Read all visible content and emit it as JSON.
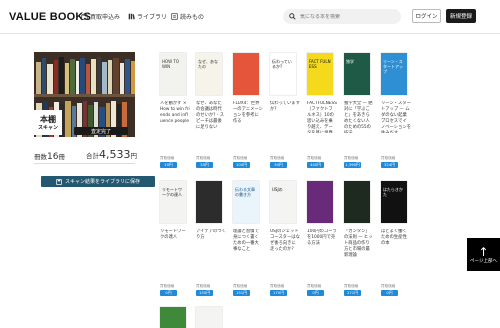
{
  "header": {
    "logo": "VALUE BOOKS",
    "nav": [
      {
        "label": "買取申込み",
        "icon": "box-icon"
      },
      {
        "label": "ライブラリ",
        "icon": "library-icon"
      },
      {
        "label": "読みもの",
        "icon": "reading-icon"
      }
    ],
    "search_placeholder": "気になる本を検索",
    "login_label": "ログイン",
    "register_label": "新規登録"
  },
  "shelf": {
    "tag_line1": "本棚",
    "tag_line2": "スキャン",
    "appraise_label": "査定完了",
    "count_prefix": "冊数",
    "count_value": "16",
    "count_unit": "冊",
    "total_prefix": "合計",
    "total_value": "4,533",
    "total_unit": "円",
    "save_label": "スキャン結果をライブラリに保存"
  },
  "books": [
    {
      "title": "人を動かす × How to win friends and influence people",
      "cover_text": "HOW TO WIN",
      "cover_color": "#f2f2ee",
      "text_color": "#333",
      "grade_label": "買取価格",
      "grade": "10円"
    },
    {
      "title": "なぜ、あなたの会議は時代のせいか? - スピーチは最後に足りない",
      "cover_text": "なぜ、あなたの",
      "cover_color": "#f6f3ea",
      "text_color": "#333",
      "grade_label": "買取価格",
      "grade": "30円"
    },
    {
      "title": "FLUX4：世界一のアニメーションを参考に作る",
      "cover_text": "",
      "cover_color": "#e4553c",
      "text_color": "#fff",
      "grade_label": "買取価格",
      "grade": "100円"
    },
    {
      "title": "伝わっていますか?",
      "cover_text": "伝わっているか?",
      "cover_color": "#ffffff",
      "text_color": "#111",
      "grade_label": "買取価格",
      "grade": "30円"
    },
    {
      "title": "FACTFULNESS（ファクトフルネス）10の思い込みを乗り越え、データを基に世界を正しく見る習慣",
      "cover_text": "FACT FULNESS",
      "cover_color": "#f4d91c",
      "text_color": "#111",
      "grade_label": "買取価格",
      "grade": "440円"
    },
    {
      "title": "独学大全 — 絶対に「学ぶこと」をあきらめたくない人のための55の技法",
      "cover_text": "独学",
      "cover_color": "#1e5a45",
      "text_color": "#fff",
      "grade_label": "買取価格",
      "grade": "1,390円"
    },
    {
      "title": "リーン・スタートアップ — ムダのない起業プロセスでイノベーションを生みだす",
      "cover_text": "リーン・スタートアップ",
      "cover_color": "#2f8fd4",
      "text_color": "#fff",
      "grade_label": "買取価格",
      "grade": "324円"
    },
    {
      "title": "リモートワークの達人",
      "cover_text": "リモートワークの達人",
      "cover_color": "#f3f3f1",
      "text_color": "#222",
      "grade_label": "買取価格",
      "grade": "0円"
    },
    {
      "title": "アイデアのつくり方",
      "cover_text": "",
      "cover_color": "#2c2c2c",
      "text_color": "#fff",
      "grade_label": "買取価格",
      "grade": "150円"
    },
    {
      "title": "理論と習慣で身につく書くための一番大事なこと",
      "cover_text": "伝わる文章の書き方",
      "cover_color": "#e9f4fb",
      "text_color": "#1b4f8a",
      "grade_label": "買取価格",
      "grade": "151円"
    },
    {
      "title": "USJのジェットコースターはなぜ後ろ向きに走ったのか?",
      "cover_text": "USJの",
      "cover_color": "#f4f4f2",
      "text_color": "#111",
      "grade_label": "買取価格",
      "grade": "170円"
    },
    {
      "title": "100円のコーラを1000円で売る方法",
      "cover_text": "",
      "cover_color": "#6a2a7a",
      "text_color": "#fff",
      "grade_label": "買取価格",
      "grade": "0円"
    },
    {
      "title": "「カンタン」の法則 — ヒット商品の作り方と市場の最新理論",
      "cover_text": "",
      "cover_color": "#1e2a20",
      "text_color": "#fff",
      "grade_label": "買取価格",
      "grade": "271円"
    },
    {
      "title": "ほどよく働くための生産性の本",
      "cover_text": "はたらきかた",
      "cover_color": "#111111",
      "text_color": "#fff",
      "grade_label": "買取価格",
      "grade": "0円"
    }
  ],
  "page_top_label": "ページ上部へ",
  "colors": {
    "accent": "#1f8ad7",
    "save_button": "#245870",
    "dark": "#1a1a1a"
  }
}
